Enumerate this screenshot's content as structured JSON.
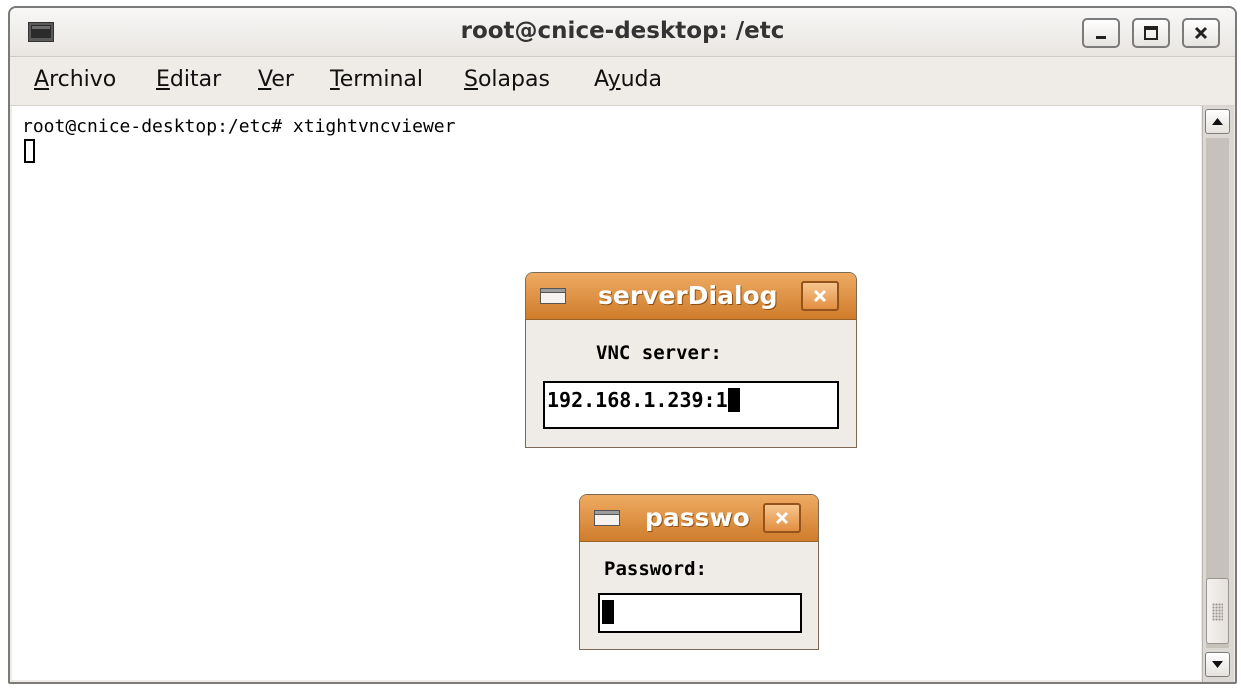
{
  "window": {
    "title": "root@cnice-desktop: /etc",
    "icon": "terminal-icon",
    "controls": [
      "minimize-icon",
      "maximize-icon",
      "close-icon"
    ]
  },
  "menubar": {
    "items": [
      {
        "mnemonic": "A",
        "rest": "rchivo"
      },
      {
        "mnemonic": "E",
        "rest": "ditar"
      },
      {
        "mnemonic": "V",
        "rest": "er"
      },
      {
        "mnemonic": "T",
        "rest": "erminal"
      },
      {
        "mnemonic": "S",
        "rest": "olapas"
      },
      {
        "pre": "A",
        "mnemonic": "y",
        "rest": "uda"
      }
    ]
  },
  "terminal": {
    "prompt_line": "root@cnice-desktop:/etc# xtightvncviewer"
  },
  "server_dialog": {
    "title": "serverDialog",
    "label": "VNC server:",
    "value": "192.168.1.239:1"
  },
  "password_dialog": {
    "title": "passwo",
    "label": "Password:",
    "value": ""
  },
  "colors": {
    "dialog_title_top": "#eeab62",
    "dialog_title_bottom": "#cf7d2c",
    "chrome": "#efebe7"
  }
}
